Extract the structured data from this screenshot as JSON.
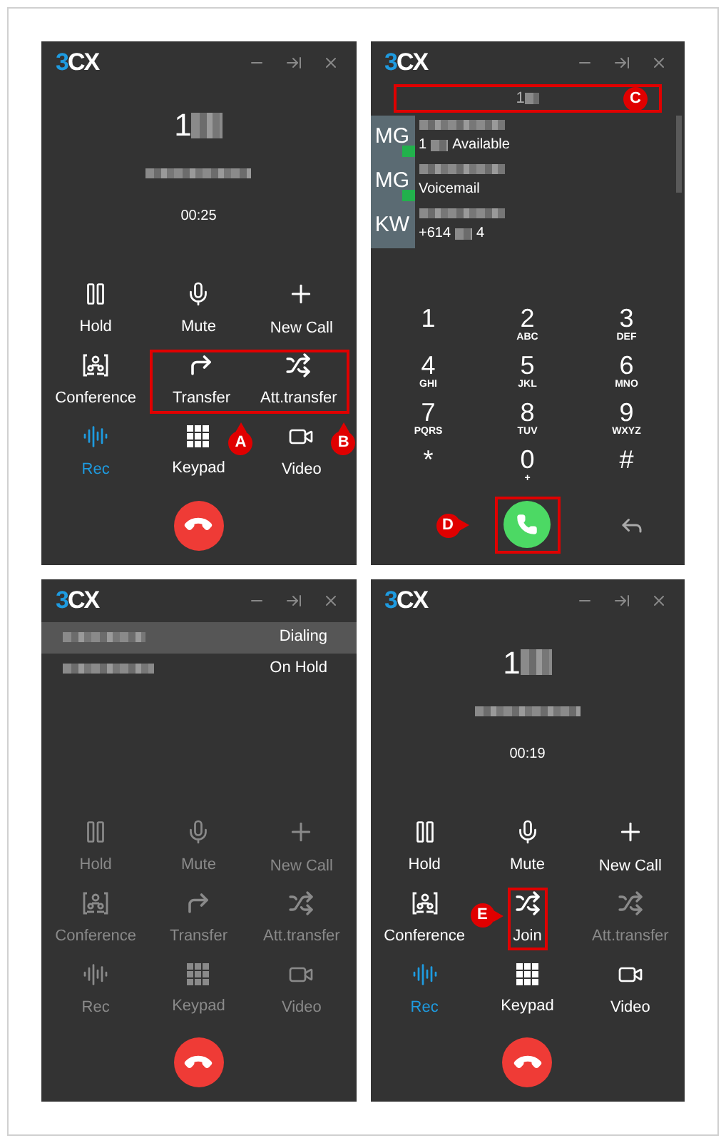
{
  "panels": [
    {
      "kind": "call",
      "logo": [
        "3",
        "CX"
      ],
      "number": "1",
      "timer": "00:25",
      "buttons": [
        {
          "label": "Hold",
          "kind": "pause",
          "disabled": false,
          "active": false,
          "highlight": false
        },
        {
          "label": "Mute",
          "kind": "mic",
          "disabled": false,
          "active": false,
          "highlight": false
        },
        {
          "label": "New Call",
          "kind": "plus",
          "disabled": false,
          "active": false,
          "highlight": false
        },
        {
          "label": "Conference",
          "kind": "conference",
          "disabled": false,
          "active": false,
          "highlight": false
        },
        {
          "label": "Transfer",
          "kind": "transfer",
          "disabled": false,
          "active": false,
          "highlight": true,
          "marker": {
            "label": "A",
            "kind": "up"
          }
        },
        {
          "label": "Att.transfer",
          "kind": "shuffle",
          "disabled": false,
          "active": false,
          "highlight": true,
          "marker": {
            "label": "B",
            "kind": "up"
          }
        },
        {
          "label": "Rec",
          "kind": "wave",
          "disabled": false,
          "active": true,
          "highlight": false
        },
        {
          "label": "Keypad",
          "kind": "keypad",
          "disabled": false,
          "active": false,
          "highlight": false
        },
        {
          "label": "Video",
          "kind": "video",
          "disabled": false,
          "active": false,
          "highlight": false
        }
      ]
    },
    {
      "kind": "dialer",
      "logo": [
        "3",
        "CX"
      ],
      "search": {
        "value": "1",
        "highlight": true,
        "marker": {
          "label": "C"
        }
      },
      "contacts": [
        {
          "initials": "MG",
          "color": "#22b14c",
          "detail": [
            {
              "kind": "text",
              "text": "1"
            },
            {
              "kind": "blur"
            },
            {
              "kind": "text",
              "text": "Available"
            }
          ]
        },
        {
          "initials": "MG",
          "color": "#22b14c",
          "detail": [
            {
              "kind": "text",
              "text": "Voicemail"
            }
          ]
        },
        {
          "initials": "KW",
          "detail": [
            {
              "kind": "text",
              "text": "+614"
            },
            {
              "kind": "blur"
            },
            {
              "kind": "text",
              "text": "4"
            }
          ]
        }
      ],
      "keys": [
        {
          "digit": "1"
        },
        {
          "digit": "2",
          "letters": "ABC"
        },
        {
          "digit": "3",
          "letters": "DEF"
        },
        {
          "digit": "4",
          "letters": "GHI"
        },
        {
          "digit": "5",
          "letters": "JKL"
        },
        {
          "digit": "6",
          "letters": "MNO"
        },
        {
          "digit": "7",
          "letters": "PQRS"
        },
        {
          "digit": "8",
          "letters": "TUV"
        },
        {
          "digit": "9",
          "letters": "WXYZ"
        },
        {
          "digit": "*"
        },
        {
          "digit": "0",
          "letters": "+"
        },
        {
          "digit": "#"
        }
      ],
      "call_button": {
        "highlight": true,
        "marker": {
          "label": "D",
          "kind": "right"
        }
      }
    },
    {
      "kind": "calls",
      "logo": [
        "3",
        "CX"
      ],
      "calls": [
        {
          "status": "Dialing",
          "selected": true
        },
        {
          "status": "On Hold",
          "selected": false
        }
      ],
      "buttons": [
        {
          "label": "Hold",
          "kind": "pause",
          "disabled": true,
          "active": false,
          "highlight": false
        },
        {
          "label": "Mute",
          "kind": "mic",
          "disabled": true,
          "active": false,
          "highlight": false
        },
        {
          "label": "New Call",
          "kind": "plus",
          "disabled": true,
          "active": false,
          "highlight": false
        },
        {
          "label": "Conference",
          "kind": "conference",
          "disabled": true,
          "active": false,
          "highlight": false
        },
        {
          "label": "Transfer",
          "kind": "transfer",
          "disabled": true,
          "active": false,
          "highlight": false
        },
        {
          "label": "Att.transfer",
          "kind": "shuffle",
          "disabled": true,
          "active": false,
          "highlight": false
        },
        {
          "label": "Rec",
          "kind": "wave",
          "disabled": true,
          "active": false,
          "highlight": false
        },
        {
          "label": "Keypad",
          "kind": "keypad",
          "disabled": true,
          "active": false,
          "highlight": false
        },
        {
          "label": "Video",
          "kind": "video",
          "disabled": true,
          "active": false,
          "highlight": false
        }
      ]
    },
    {
      "kind": "call",
      "logo": [
        "3",
        "CX"
      ],
      "number": "1",
      "timer": "00:19",
      "buttons": [
        {
          "label": "Hold",
          "kind": "pause",
          "disabled": false,
          "active": false,
          "highlight": false
        },
        {
          "label": "Mute",
          "kind": "mic",
          "disabled": false,
          "active": false,
          "highlight": false
        },
        {
          "label": "New Call",
          "kind": "plus",
          "disabled": false,
          "active": false,
          "highlight": false
        },
        {
          "label": "Conference",
          "kind": "conference",
          "disabled": false,
          "active": false,
          "highlight": false
        },
        {
          "label": "Join",
          "kind": "shuffle",
          "disabled": false,
          "active": false,
          "highlight": true,
          "marker": {
            "label": "E",
            "kind": "right"
          }
        },
        {
          "label": "Att.transfer",
          "kind": "shuffle",
          "disabled": true,
          "active": false,
          "highlight": false
        },
        {
          "label": "Rec",
          "kind": "wave",
          "disabled": false,
          "active": true,
          "highlight": false
        },
        {
          "label": "Keypad",
          "kind": "keypad",
          "disabled": false,
          "active": false,
          "highlight": false
        },
        {
          "label": "Video",
          "kind": "video",
          "disabled": false,
          "active": false,
          "highlight": false
        }
      ]
    }
  ]
}
